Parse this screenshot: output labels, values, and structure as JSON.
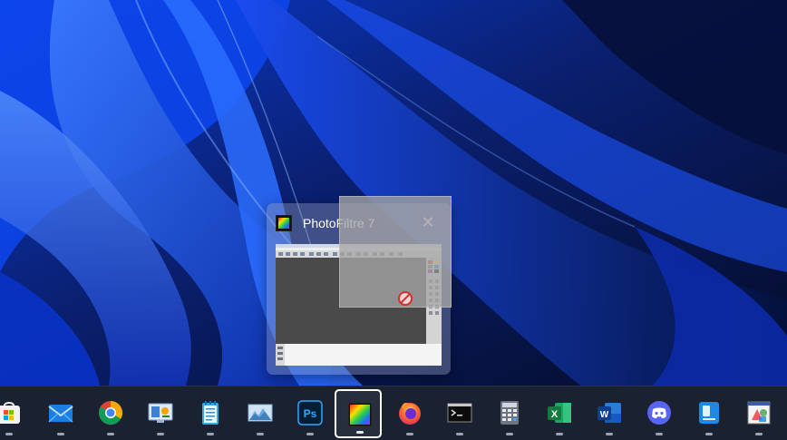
{
  "preview": {
    "app_title": "PhotoFiltre 7",
    "app_icon": "photofiltre-icon",
    "close_icon": "close-icon"
  },
  "drag": {
    "indicator_icon": "no-drop-icon"
  },
  "taskbar": {
    "active_app": "PhotoFiltre 7",
    "items": [
      {
        "name": "store",
        "icon": "store-icon"
      },
      {
        "name": "mail",
        "icon": "mail-icon"
      },
      {
        "name": "chrome",
        "icon": "chrome-icon"
      },
      {
        "name": "control-panel",
        "icon": "control-panel-icon"
      },
      {
        "name": "notepad",
        "icon": "notepad-icon"
      },
      {
        "name": "image-viewer",
        "icon": "image-viewer-icon"
      },
      {
        "name": "photoshop",
        "icon": "photoshop-icon",
        "label": "Ps"
      },
      {
        "name": "photofiltre",
        "icon": "photofiltre-icon"
      },
      {
        "name": "firefox",
        "icon": "firefox-icon"
      },
      {
        "name": "command-prompt",
        "icon": "terminal-icon"
      },
      {
        "name": "calculator",
        "icon": "calculator-icon"
      },
      {
        "name": "excel",
        "icon": "excel-icon",
        "label": "X"
      },
      {
        "name": "word",
        "icon": "word-icon",
        "label": "W"
      },
      {
        "name": "discord",
        "icon": "discord-icon"
      },
      {
        "name": "remote-desktop",
        "icon": "remote-desktop-icon"
      },
      {
        "name": "paint",
        "icon": "paint-icon"
      }
    ]
  },
  "colors": {
    "wallpaper_base": "#06123a",
    "wallpaper_accent": "#1f5bff",
    "taskbar": "#1a2131",
    "active_outline": "#ffffff"
  }
}
